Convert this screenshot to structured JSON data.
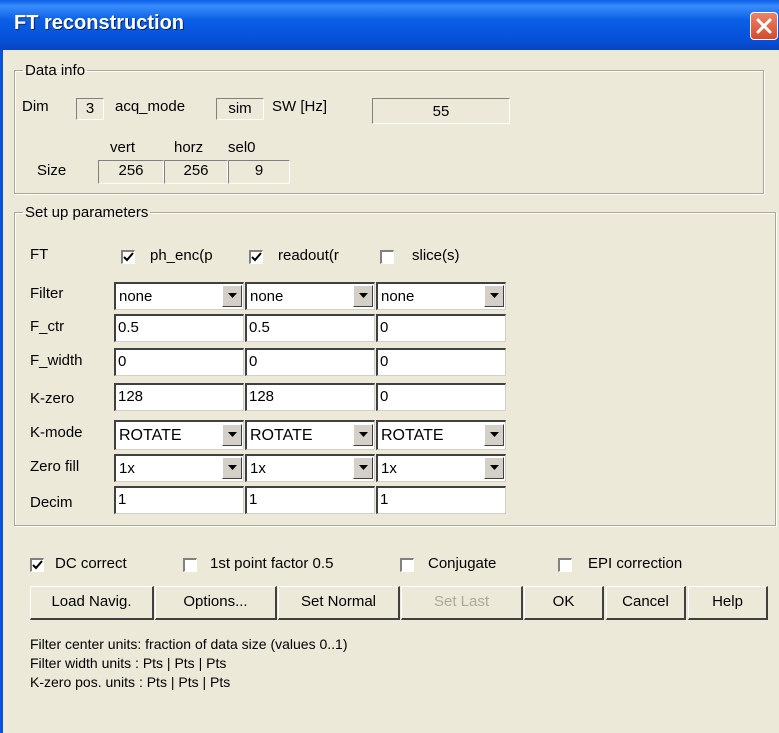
{
  "window": {
    "title": "FT reconstruction"
  },
  "data_info": {
    "legend": "Data info",
    "dim_label": "Dim",
    "dim_value": "3",
    "acq_mode_label": "acq_mode",
    "acq_mode_value": "sim",
    "sw_label": "SW [Hz]",
    "sw_value": "55",
    "size_label": "Size",
    "size_headers": [
      "vert",
      "horz",
      "sel0"
    ],
    "size_values": [
      "256",
      "256",
      "9"
    ]
  },
  "setup": {
    "legend": "Set up parameters",
    "ft_label": "FT",
    "ft_checks": [
      {
        "label": "ph_enc(p",
        "checked": true
      },
      {
        "label": "readout(r",
        "checked": true
      },
      {
        "label": "slice(s)",
        "checked": false
      }
    ],
    "rows": [
      {
        "label": "Filter",
        "kind": "select",
        "values": [
          "none",
          "none",
          "none"
        ]
      },
      {
        "label": "F_ctr",
        "kind": "field",
        "values": [
          "0.5",
          "0.5",
          "0"
        ]
      },
      {
        "label": "F_width",
        "kind": "field",
        "values": [
          "0",
          "0",
          "0"
        ]
      },
      {
        "label": "K-zero",
        "kind": "field",
        "values": [
          "128",
          "128",
          "0"
        ]
      },
      {
        "label": "K-mode",
        "kind": "select",
        "values": [
          "ROTATE",
          "ROTATE",
          "ROTATE"
        ]
      },
      {
        "label": "Zero fill",
        "kind": "select",
        "values": [
          "1x",
          "1x",
          "1x"
        ]
      },
      {
        "label": "Decim",
        "kind": "field",
        "values": [
          "1",
          "1",
          "1"
        ]
      }
    ]
  },
  "options": [
    {
      "label": "DC correct",
      "checked": true
    },
    {
      "label": "1st point factor 0.5",
      "checked": false
    },
    {
      "label": "Conjugate",
      "checked": false
    },
    {
      "label": "EPI correction",
      "checked": false
    }
  ],
  "buttons": {
    "load_navig": "Load Navig.",
    "options": "Options...",
    "set_normal": "Set Normal",
    "set_last": "Set Last",
    "ok": "OK",
    "cancel": "Cancel",
    "help": "Help"
  },
  "info_lines": [
    "Filter center units: fraction of data size (values 0..1)",
    "Filter width units : Pts | Pts | Pts",
    "K-zero pos. units : Pts | Pts | Pts"
  ],
  "colors": {
    "titlebar": "#0a5fe6",
    "dialog_bg": "#ece9d8",
    "close": "#d64a2a"
  }
}
